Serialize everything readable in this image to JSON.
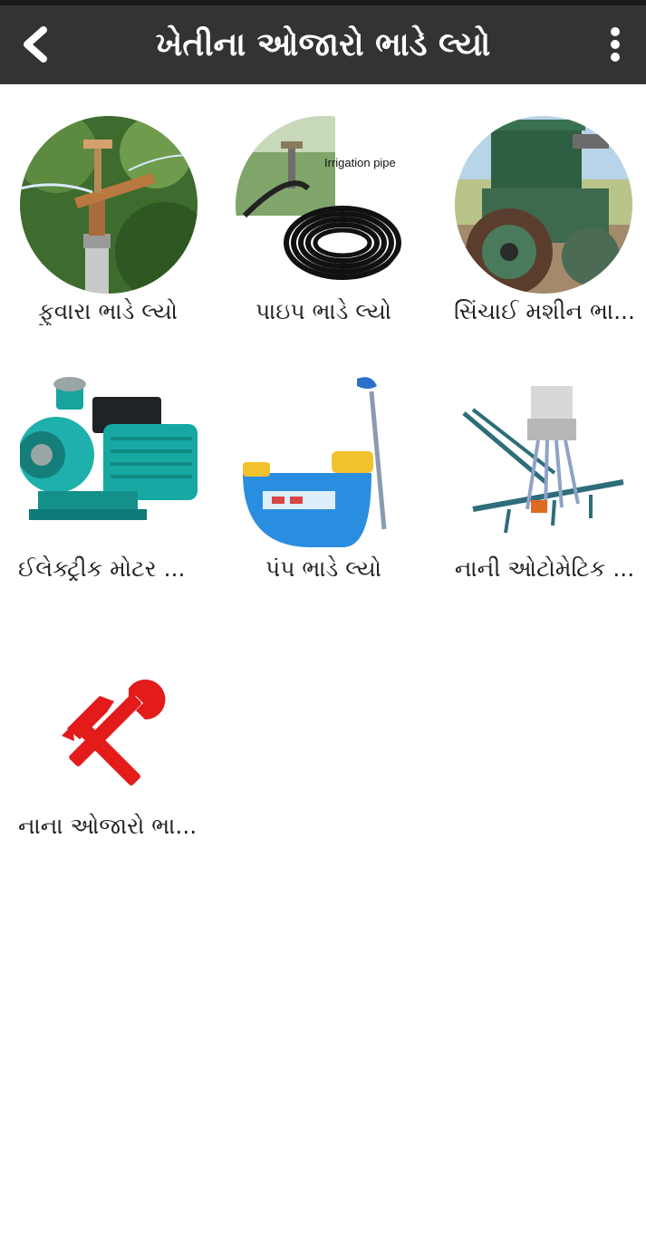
{
  "header": {
    "title": "ખેતીના ઓજારો ભાડે લ્યો",
    "back_icon": "chevron-left-icon",
    "menu_icon": "more-vertical-icon"
  },
  "colors": {
    "app_bar": "#333333",
    "status_strip": "#1a1a1a",
    "label_text": "#222222",
    "tools_icon": "#e31b1b"
  },
  "items": [
    {
      "label": "ફુવારા ભાડે લ્યો",
      "image": "sprinkler-photo"
    },
    {
      "label": "પાઇપ ભાડે લ્યો",
      "image": "irrigation-pipe-photo",
      "image_text": "Irrigation pipe"
    },
    {
      "label": "સિંચાઈ મશીન ભા...",
      "image": "diesel-engine-photo"
    },
    {
      "label": "ઈલેક્ટ્રીક મોટર ...",
      "image": "electric-motor-pump-photo"
    },
    {
      "label": "પંપ ભાડે લ્યો",
      "image": "sprayer-pump-photo"
    },
    {
      "label": "નાની ઓટોમેટિક ...",
      "image": "seed-drill-photo"
    },
    {
      "label": "નાના ઓજારો ભા...",
      "image": "hammer-wrench-icon"
    }
  ]
}
